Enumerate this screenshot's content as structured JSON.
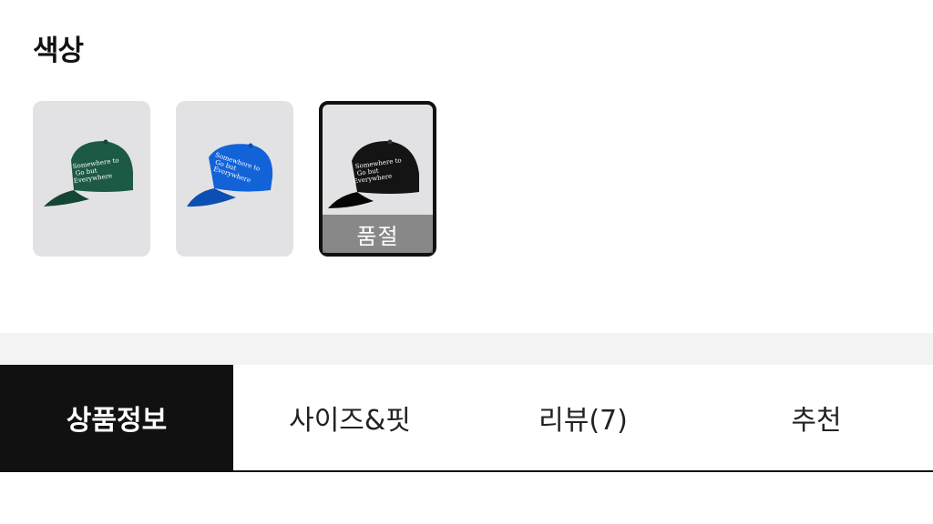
{
  "color_section": {
    "title": "색상",
    "swatches": [
      {
        "color_name": "green",
        "cap_color": "#1d5a45",
        "cap_shade": "#154634",
        "selected": false,
        "sold_out": false
      },
      {
        "color_name": "blue",
        "cap_color": "#1263d8",
        "cap_shade": "#0c4fb2",
        "selected": false,
        "sold_out": false
      },
      {
        "color_name": "black",
        "cap_color": "#141414",
        "cap_shade": "#050505",
        "selected": true,
        "sold_out": true,
        "sold_out_label": "품절"
      }
    ],
    "cap_text_lines": [
      "Somewhere to",
      "Go but",
      "Everywhere"
    ]
  },
  "tabs": [
    {
      "label": "상품정보",
      "active": true
    },
    {
      "label": "사이즈&핏",
      "active": false
    },
    {
      "label": "리뷰(7)",
      "active": false
    },
    {
      "label": "추천",
      "active": false
    }
  ],
  "colors": {
    "accent": "#111111",
    "swatch_bg": "#e2e2e4",
    "band": "#f3f3f4"
  }
}
